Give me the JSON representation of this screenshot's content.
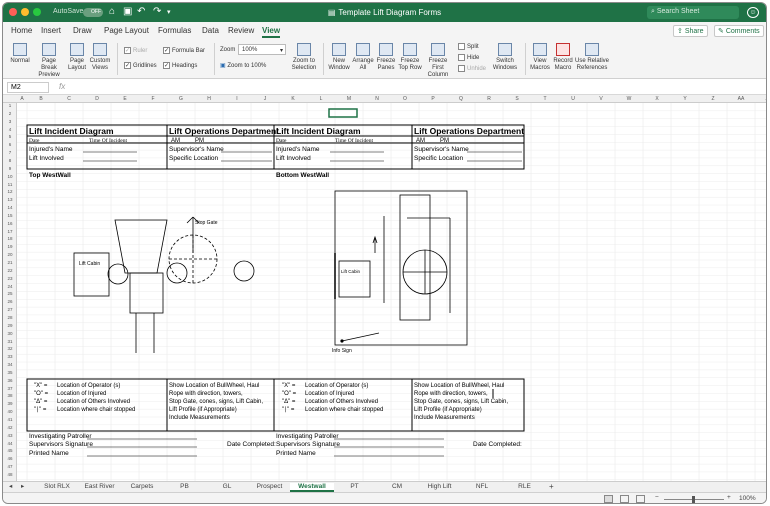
{
  "titlebar": {
    "autosave_label": "AutoSave",
    "autosave_state": "OFF",
    "title": "Template Lift Diagram Forms",
    "search_placeholder": "Search Sheet",
    "user_icon": "user-icon"
  },
  "menu": {
    "items": [
      "Home",
      "Insert",
      "Draw",
      "Page Layout",
      "Formulas",
      "Data",
      "Review",
      "View"
    ],
    "active": "View",
    "share": "Share",
    "comments": "Comments"
  },
  "ribbon": {
    "normal": "Normal",
    "page_break": "Page Break Preview",
    "page_layout": "Page Layout",
    "custom_views": "Custom Views",
    "ruler": "Ruler",
    "formula_bar": "Formula Bar",
    "gridlines": "Gridlines",
    "headings": "Headings",
    "zoom_label": "Zoom",
    "zoom_value": "100%",
    "zoom_100": "Zoom to 100%",
    "zoom_selection": "Zoom to Selection",
    "new_window": "New Window",
    "arrange_all": "Arrange All",
    "freeze_panes": "Freeze Panes",
    "freeze_top_row": "Freeze Top Row",
    "freeze_first_col": "Freeze First Column",
    "split": "Split",
    "hide": "Hide",
    "unhide": "Unhide",
    "switch_windows": "Switch Windows",
    "view_macros": "View Macros",
    "record_macro": "Record Macro",
    "use_relative": "Use Relative References"
  },
  "formula": {
    "namebox": "M2",
    "fx": "fx"
  },
  "columns": [
    "A",
    "B",
    "C",
    "D",
    "E",
    "F",
    "G",
    "H",
    "I",
    "J",
    "K",
    "L",
    "M",
    "N",
    "O",
    "P",
    "Q",
    "R",
    "S",
    "T",
    "U",
    "V",
    "W",
    "X",
    "Y",
    "Z",
    "AA",
    "AB"
  ],
  "rows": [
    "1",
    "2",
    "3",
    "4",
    "5",
    "6",
    "7",
    "8",
    "9",
    "10",
    "11",
    "12",
    "13",
    "14",
    "15",
    "16",
    "17",
    "18",
    "19",
    "20",
    "21",
    "22",
    "23",
    "24",
    "25",
    "26",
    "27",
    "28",
    "29",
    "30",
    "31",
    "32",
    "33",
    "34",
    "35",
    "36",
    "37",
    "38",
    "39",
    "40",
    "41",
    "42",
    "43",
    "44",
    "45",
    "46",
    "47",
    "48"
  ],
  "sheet": {
    "left": {
      "title": "Lift Incident Diagram",
      "date": "Date",
      "time": "Time Of Incident",
      "injured": "Injured's Name",
      "lift": "Lift Involved",
      "section": "Top WestWall",
      "lift_cabin": "Lift Cabin",
      "stop_gate": "Stop Gate"
    },
    "right": {
      "title": "Lift Incident Diagram",
      "date": "Date",
      "time": "Time Of Incident",
      "injured": "Injured's Name",
      "lift": "Lift Involved",
      "section": "Bottom WestWall",
      "lift_cabin": "Lift Cabin",
      "info_sign": "Info Sign"
    },
    "ops": {
      "title": "Lift Operations Department",
      "am": "AM",
      "pm": "PM",
      "supervisor": "Supervisor's Name",
      "location": "Specific Location"
    },
    "legend": [
      {
        "sym": "\"X\" =",
        "text": "Location of Operator (s)"
      },
      {
        "sym": "\"O\" =",
        "text": "Location of Injured"
      },
      {
        "sym": "\"Δ\" =",
        "text": "Location of Others Involved"
      },
      {
        "sym": "\"∣\" =",
        "text": "Location where chair stopped"
      }
    ],
    "legend_right": [
      "Show Location of BullWheel, Haul",
      "Rope with direction, towers,",
      "Stop Gate, cones, signs, Lift Cabin,",
      "Lift Profile (if Appropriate)",
      "Include Measurements"
    ],
    "footer": {
      "patroller": "Investigating Patroller",
      "supervisor_sig": "Supervisors Signature",
      "date_completed": "Date Completed:",
      "printed": "Printed Name"
    }
  },
  "tabs": [
    "Slot RLX",
    "East River",
    "Carpets",
    "PB",
    "GL",
    "Prospect",
    "Westwall",
    "PT",
    "CM",
    "High Lift",
    "NFL",
    "RLE"
  ],
  "active_tab": "Westwall",
  "status": {
    "zoom": "100%"
  }
}
